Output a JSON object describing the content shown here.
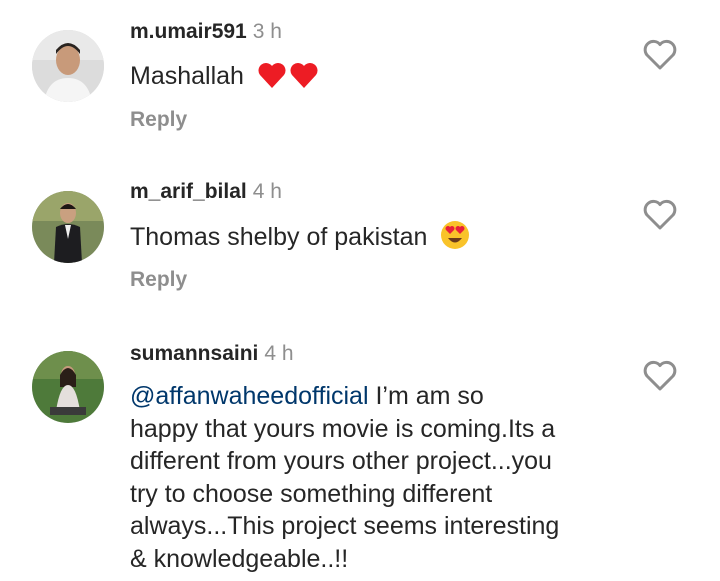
{
  "comments": [
    {
      "username": "m.umair591",
      "time": "3 h",
      "text": "Mashallah",
      "emoji": "❤️❤️",
      "reply": "Reply"
    },
    {
      "username": "m_arif_bilal",
      "time": "4 h",
      "text": "Thomas shelby of pakistan",
      "emoji": "😍",
      "reply": "Reply"
    },
    {
      "username": "sumannsaini",
      "time": "4 h",
      "mention": "@affanwaheedofficial",
      "text_lines": [
        " I’m am so",
        "happy that yours movie is coming.Its a",
        "different from yours other project...you",
        "try to choose something different",
        "always...This project seems interesting",
        "& knowledgeable..!!"
      ]
    }
  ],
  "icons": {
    "like": "heart-outline-icon",
    "heart_color": "#ed1c24",
    "star_eyes": "heart-eyes-emoji-icon"
  }
}
